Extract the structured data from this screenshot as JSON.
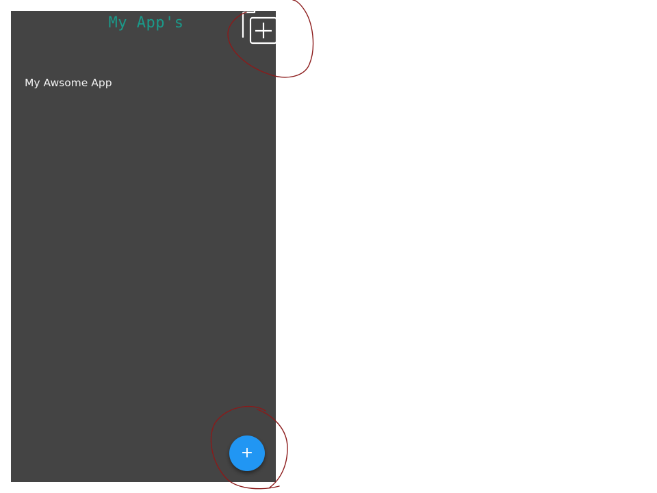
{
  "header": {
    "title": "My App's",
    "add_icon": "library-add-icon"
  },
  "apps": [
    {
      "name": "My Awsome App"
    }
  ],
  "fab": {
    "label": "+",
    "icon": "plus-icon",
    "color": "#2196f3"
  },
  "colors": {
    "screen_background": "#444444",
    "title": "#1a9a8a",
    "annotation": "#8b1a1a"
  }
}
